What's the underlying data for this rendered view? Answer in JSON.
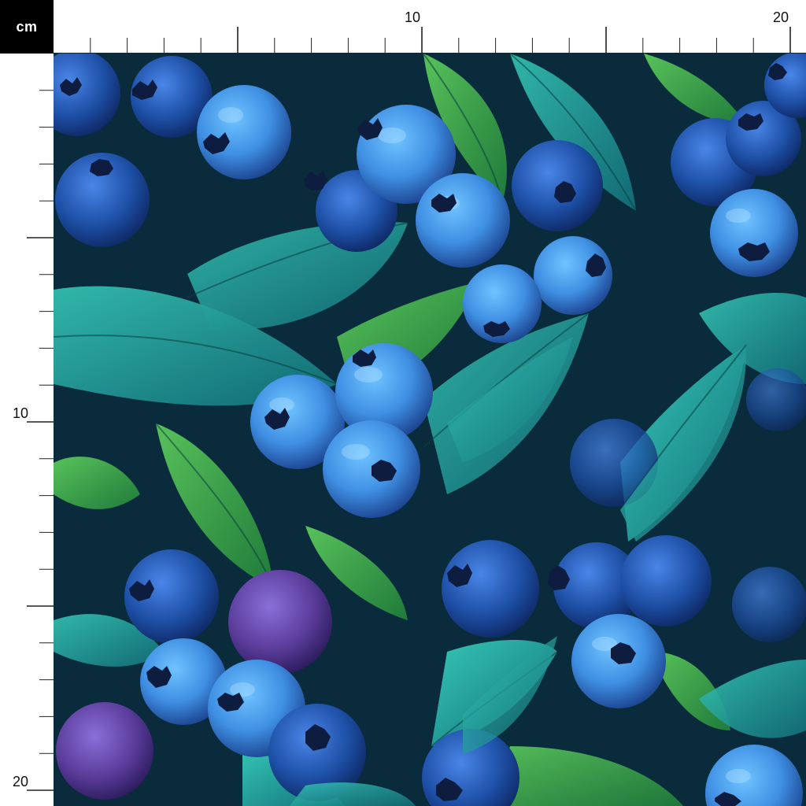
{
  "ruler": {
    "unit": "cm",
    "top_labels": [
      "10",
      "20"
    ],
    "left_labels": [
      "10",
      "20"
    ]
  },
  "pattern": {
    "subject": "blueberries-and-leaves",
    "colors": {
      "background": "#0b2f3f",
      "berry_blue": "#3f8fe3",
      "berry_dark": "#1d4fa5",
      "berry_purple": "#5a3c9a",
      "berry_crown": "#0d1c3f",
      "leaf_teal": "#1fa3a0",
      "leaf_green": "#2f9a46",
      "leaf_dark": "#0f5a63"
    }
  }
}
